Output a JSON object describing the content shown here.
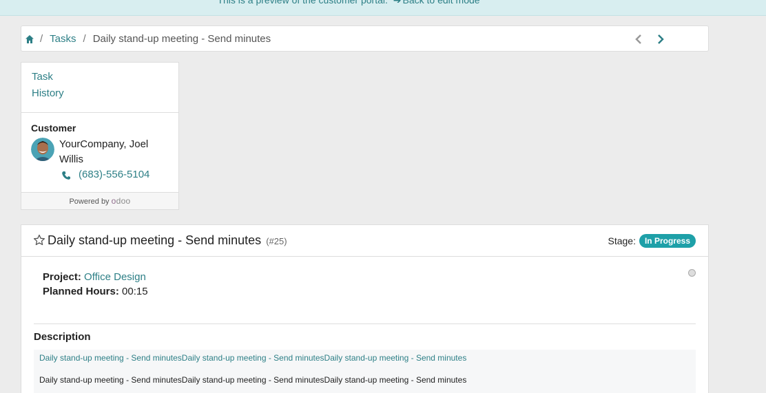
{
  "preview_bar": {
    "text": "This is a preview of the customer portal.",
    "link": "Back to edit mode"
  },
  "breadcrumb": {
    "sep1": "/",
    "tasks": "Tasks",
    "sep2": "/",
    "current": "Daily stand-up meeting - Send minutes"
  },
  "side_nav": {
    "task": "Task",
    "history": "History"
  },
  "customer": {
    "title": "Customer",
    "name": "YourCompany, Joel Willis",
    "phone": "(683)-556-5104"
  },
  "powered": {
    "label": "Powered by",
    "brand_o1": "o",
    "brand_rest": "doo"
  },
  "task": {
    "title": "Daily stand-up meeting - Send minutes",
    "ref": "(#25)",
    "stage_label": "Stage:",
    "stage_value": "In Progress",
    "project_label": "Project:",
    "project_value": "Office Design",
    "hours_label": "Planned Hours:",
    "hours_value": "00:15",
    "description_title": "Description",
    "description_line1": "Daily stand-up meeting - Send minutesDaily stand-up meeting - Send minutesDaily stand-up meeting - Send minutes",
    "description_line2": "Daily stand-up meeting - Send minutesDaily stand-up meeting - Send minutesDaily stand-up meeting - Send minutes"
  },
  "colors": {
    "accent": "#2d7f86",
    "badge": "#1ea0a8",
    "preview_bg": "#d8eef0"
  }
}
